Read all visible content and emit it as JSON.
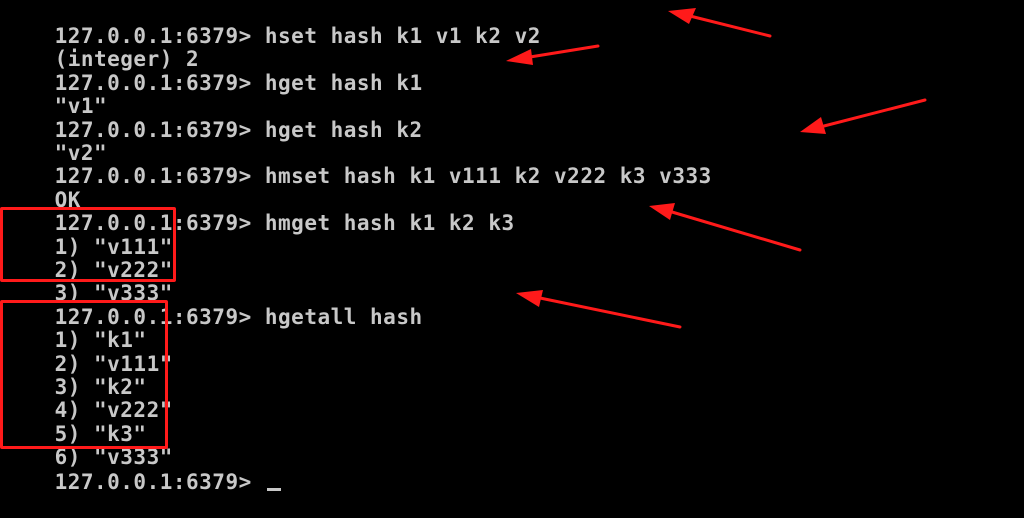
{
  "terminal": {
    "lines": [
      {
        "prompt": "127.0.0.1:6379>",
        "command": "hset hash k1 v1 k2 v2"
      },
      {
        "output": "(integer) 2"
      },
      {
        "prompt": "127.0.0.1:6379>",
        "command": "hget hash k1"
      },
      {
        "output": "\"v1\""
      },
      {
        "prompt": "127.0.0.1:6379>",
        "command": "hget hash k2"
      },
      {
        "output": "\"v2\""
      },
      {
        "prompt": "127.0.0.1:6379>",
        "command": "hmset hash k1 v111 k2 v222 k3 v333"
      },
      {
        "output": "OK"
      },
      {
        "prompt": "127.0.0.1:6379>",
        "command": "hmget hash k1 k2 k3"
      },
      {
        "output": "1) \"v111\""
      },
      {
        "output": "2) \"v222\""
      },
      {
        "output": "3) \"v333\""
      },
      {
        "prompt": "127.0.0.1:6379>",
        "command": "hgetall hash"
      },
      {
        "output": "1) \"k1\""
      },
      {
        "output": "2) \"v111\""
      },
      {
        "output": "3) \"k2\""
      },
      {
        "output": "4) \"v222\""
      },
      {
        "output": "5) \"k3\""
      },
      {
        "output": "6) \"v333\""
      },
      {
        "prompt": "127.0.0.1:6379>",
        "command": ""
      }
    ]
  },
  "colors": {
    "background": "#000000",
    "text": "#c8c8c8",
    "annotation": "#ff1a1a"
  }
}
